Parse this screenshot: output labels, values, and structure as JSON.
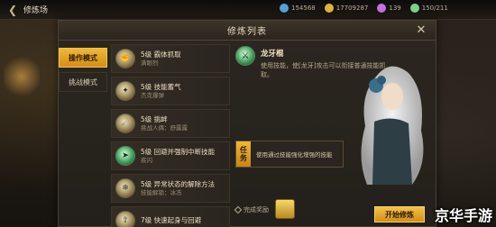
{
  "topbar": {
    "back_icon": "back-arrow-icon",
    "title": "修炼场",
    "currencies": [
      {
        "icon": "coin-icon",
        "color": "#4fa3d9",
        "value": "154568"
      },
      {
        "icon": "gold-icon",
        "color": "#e0b23a",
        "value": "17709287"
      },
      {
        "icon": "gem-icon",
        "color": "#c96ee0",
        "value": "139"
      },
      {
        "icon": "energy-icon",
        "color": "#7cd18a",
        "value": "150/211"
      }
    ]
  },
  "panel": {
    "title": "修炼列表",
    "close_icon": "close-icon"
  },
  "tabs": [
    {
      "label": "操作模式",
      "active": true
    },
    {
      "label": "挑战模式",
      "active": false
    }
  ],
  "skills": [
    {
      "name": "5级 霸体抓取",
      "sub": "满眼烈",
      "icon": "grab-icon",
      "color": "gold"
    },
    {
      "name": "5级 技能蓄气",
      "sub": "杰克爆弹",
      "icon": "charge-icon",
      "color": "gold"
    },
    {
      "name": "5级 挑衅",
      "sub": "挑战人偶：舒露露",
      "icon": "taunt-icon",
      "color": "gold"
    },
    {
      "name": "5级 回避并强制中断技能",
      "sub": "疾闪",
      "icon": "dodge-icon",
      "color": "green"
    },
    {
      "name": "5级 异常状态的解除方法",
      "sub": "技能解锁：冰冻",
      "icon": "cleanse-icon",
      "color": "gold"
    },
    {
      "name": "7级 快速起身与回避",
      "sub": "",
      "icon": "rise-icon",
      "color": "gold"
    }
  ],
  "detail": {
    "name": "龙牙棍",
    "desc": "使用技能，使[龙牙]攻击可以衔接普通技能抓取。",
    "icon": "dragon-fang-icon"
  },
  "task": {
    "tag": "任务",
    "text": "使用通过技能强化增强的技能"
  },
  "reward": {
    "label": "完成奖励",
    "icon": "gold-bar-icon"
  },
  "start_button": "开始修炼",
  "watermark": "京华手游",
  "colors": {
    "accent": "#e8a628",
    "panel_bg": "#2c2720",
    "text": "#d9cfb6"
  }
}
